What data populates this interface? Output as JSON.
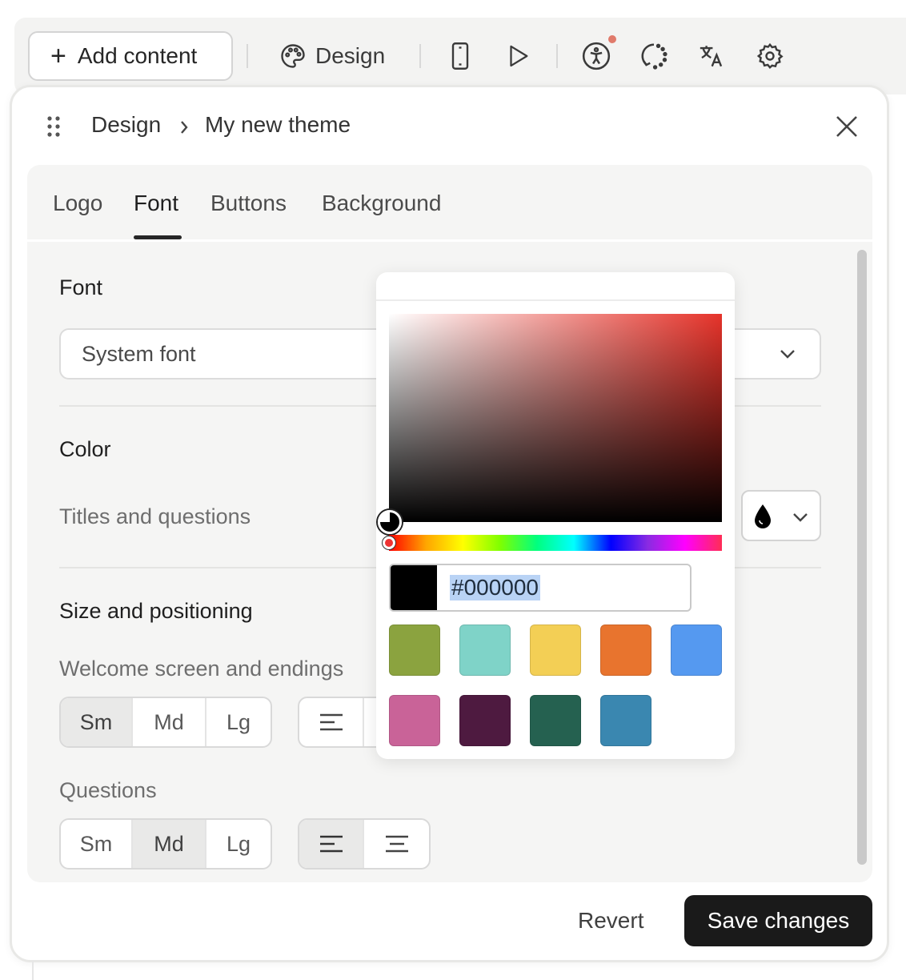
{
  "toolbar": {
    "add_content_label": "Add content",
    "design_label": "Design",
    "icons": [
      "plus-icon",
      "palette-icon",
      "mobile-icon",
      "play-icon",
      "accessibility-icon",
      "loading-icon",
      "translate-icon",
      "gear-icon"
    ],
    "notification_color": "#e07a6b"
  },
  "panel": {
    "breadcrumb": {
      "root": "Design",
      "current": "My new theme"
    },
    "tabs": [
      "Logo",
      "Font",
      "Buttons",
      "Background"
    ],
    "active_tab": "Font",
    "font": {
      "section_title": "Font",
      "selected": "System font"
    },
    "color": {
      "section_title": "Color",
      "label": "Titles and questions"
    },
    "size": {
      "section_title": "Size and positioning",
      "welcome_label": "Welcome screen and endings",
      "questions_label": "Questions",
      "welcome_sizes": [
        "Sm",
        "Md",
        "Lg"
      ],
      "welcome_selected": "Sm",
      "question_sizes": [
        "Sm",
        "Md",
        "Lg"
      ],
      "question_selected": "Md",
      "question_alignment_selected": "left"
    },
    "footer": {
      "revert_label": "Revert",
      "save_label": "Save changes"
    }
  },
  "color_picker": {
    "hex_value": "#000000",
    "hue_color": "#e6332a",
    "presets": [
      "#8ba33f",
      "#7fd3c8",
      "#f3cf55",
      "#e8742e",
      "#5599f0",
      "#c96398",
      "#4e1a40",
      "#256150",
      "#3a87b0"
    ]
  }
}
